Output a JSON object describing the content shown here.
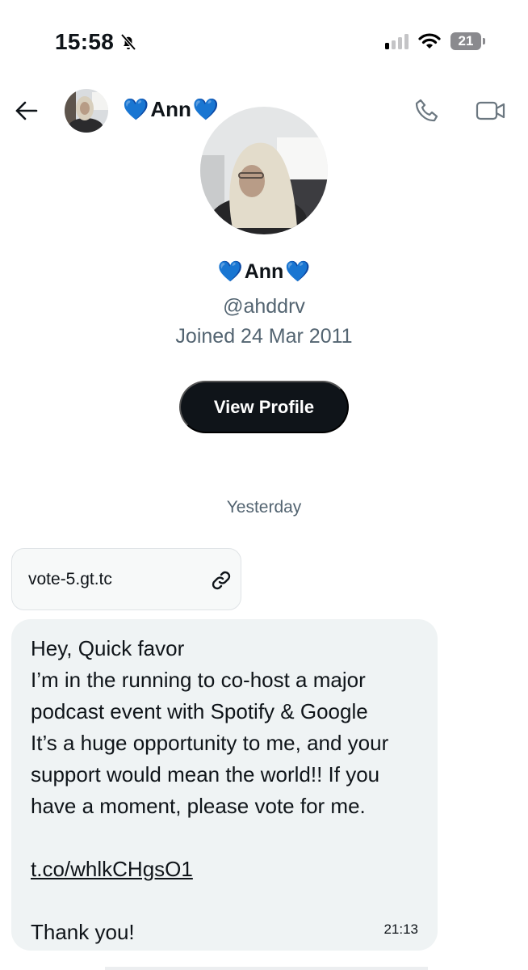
{
  "status_bar": {
    "time": "15:58",
    "mute_icon": "bell-slash-icon",
    "signal_bars_active": 1,
    "signal_bars_total": 4,
    "wifi_icon": "wifi-icon",
    "battery_level": "21"
  },
  "header": {
    "back_icon": "arrow-left-icon",
    "name_prefix": "💙",
    "name": "Ann",
    "name_suffix": "💙",
    "call_icon": "phone-icon",
    "video_icon": "video-camera-icon"
  },
  "profile": {
    "name_prefix": "💙",
    "name": "Ann",
    "name_suffix": "💙",
    "handle": "@ahddrv",
    "joined": "Joined 24 Mar 2011",
    "view_profile_label": "View Profile"
  },
  "conversation": {
    "date_separator": "Yesterday",
    "link_card": {
      "domain": "vote-5.gt.tc",
      "icon": "link-icon"
    },
    "message": {
      "lines": [
        "Hey, Quick favor",
        "I’m in the running to co-host a major",
        "podcast event with Spotify & Google",
        "It’s a huge opportunity to me, and your",
        "support would mean the world!! If you",
        "have a moment, please vote for me."
      ],
      "link": "t.co/whlkCHgsO1",
      "closing": "Thank you!",
      "time": "21:13"
    }
  },
  "colors": {
    "text_primary": "#0f1419",
    "text_secondary": "#536471",
    "button_bg": "#0f1419",
    "bubble_bg": "#eff3f4",
    "card_border": "#dfe3e6"
  }
}
